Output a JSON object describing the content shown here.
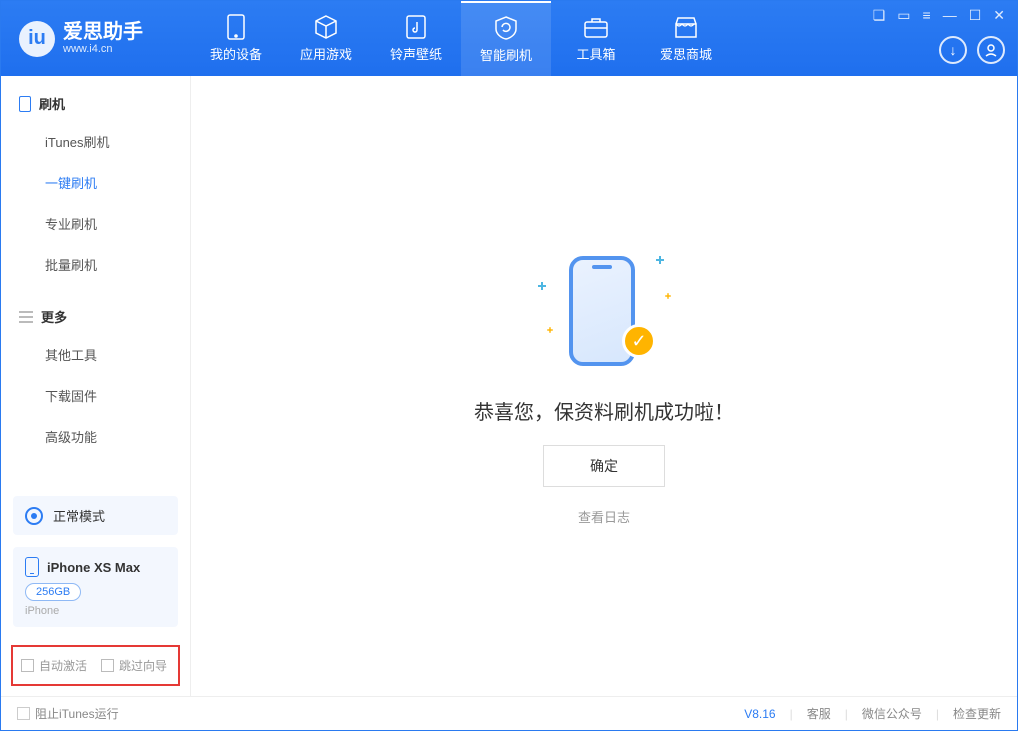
{
  "header": {
    "app_title": "爱思助手",
    "app_sub": "www.i4.cn",
    "tabs": [
      {
        "label": "我的设备"
      },
      {
        "label": "应用游戏"
      },
      {
        "label": "铃声壁纸"
      },
      {
        "label": "智能刷机"
      },
      {
        "label": "工具箱"
      },
      {
        "label": "爱思商城"
      }
    ],
    "active_tab_index": 3
  },
  "sidebar": {
    "sections": [
      {
        "title": "刷机",
        "items": [
          "iTunes刷机",
          "一键刷机",
          "专业刷机",
          "批量刷机"
        ],
        "active_index": 1
      },
      {
        "title": "更多",
        "items": [
          "其他工具",
          "下载固件",
          "高级功能"
        ],
        "active_index": -1
      }
    ],
    "mode_card": {
      "label": "正常模式"
    },
    "device_card": {
      "name": "iPhone XS Max",
      "capacity": "256GB",
      "type": "iPhone"
    },
    "options": {
      "auto_activate": "自动激活",
      "skip_guide": "跳过向导"
    }
  },
  "content": {
    "success_text": "恭喜您，保资料刷机成功啦！",
    "ok_button": "确定",
    "view_log": "查看日志"
  },
  "footer": {
    "block_itunes": "阻止iTunes运行",
    "version": "V8.16",
    "links": [
      "客服",
      "微信公众号",
      "检查更新"
    ]
  },
  "colors": {
    "primary": "#2c7cf3",
    "accent": "#ffb400"
  }
}
